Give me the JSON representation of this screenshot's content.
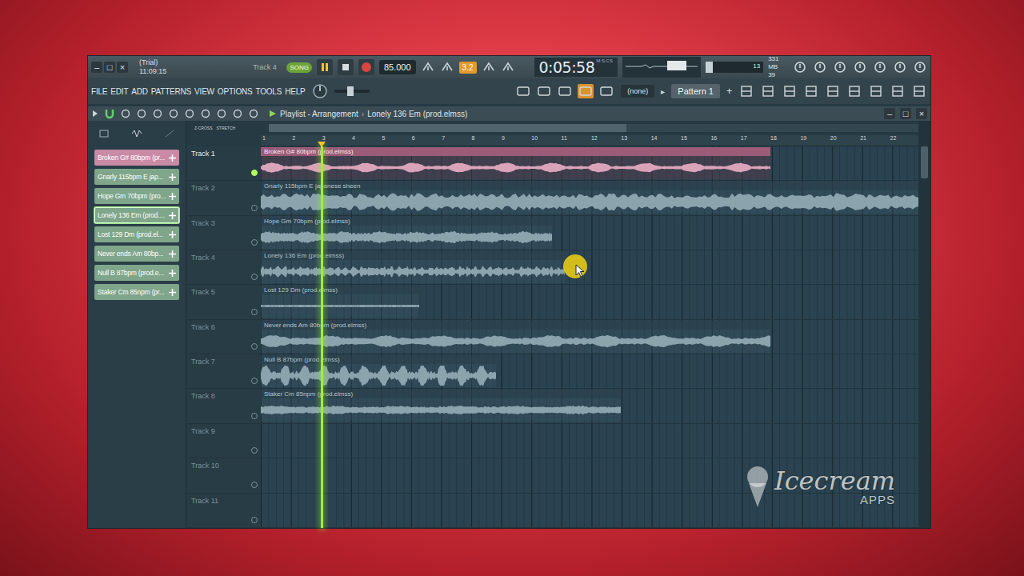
{
  "window": {
    "buttons": [
      "–",
      "□",
      "×"
    ],
    "trial": "(Trial)",
    "clock": "11:09:15",
    "hint": "Track 4"
  },
  "transport": {
    "mode": {
      "label": "SONG",
      "selected": true
    },
    "playing": true,
    "recording": false,
    "tempo": "85.000",
    "snap_badge": {
      "label": "3.2",
      "selected": true
    },
    "time": "0:05:58",
    "time_unit": "M:S:CS",
    "cpu": "13",
    "memory": "331 MB",
    "polyphony": "39",
    "cpu_level": 0.13
  },
  "menu": [
    "FILE",
    "EDIT",
    "ADD",
    "PATTERNS",
    "VIEW",
    "OPTIONS",
    "TOOLS",
    "HELP"
  ],
  "pattern_selector": {
    "channel": "(none)",
    "arrow": "▸",
    "pattern": "Pattern 1",
    "add": "+"
  },
  "playlist": {
    "title": "Playlist - Arrangement",
    "separator": "›",
    "current": "Lonely 136 Em (prod.elmss)",
    "buttons": [
      "–",
      "□",
      "×"
    ],
    "tool_labels": [
      "Z-CROSS",
      "STRETCH"
    ],
    "ruler": [
      "1",
      "2",
      "3",
      "4",
      "5",
      "6",
      "7",
      "8",
      "9",
      "10",
      "11",
      "12",
      "13",
      "14",
      "15",
      "16",
      "17",
      "18",
      "19",
      "20",
      "21",
      "22"
    ],
    "playhead": 0.091,
    "overview": {
      "level": 0.55
    }
  },
  "picker": [
    {
      "label": "Broken G# 80bpm (pr...",
      "color": "#c98aa6",
      "selected": false
    },
    {
      "label": "Gnarly 115bpm E jap...",
      "color": "#7fa58a",
      "selected": false
    },
    {
      "label": "Hope Gm 70bpm (pro...",
      "color": "#7fa58a",
      "selected": false
    },
    {
      "label": "Lonely 136 Em (prod....",
      "color": "#7fa58a",
      "selected": true
    },
    {
      "label": "Lost 129 Dm (prod.el...",
      "color": "#7fa58a",
      "selected": false
    },
    {
      "label": "Never ends Am 80bp...",
      "color": "#7fa58a",
      "selected": false
    },
    {
      "label": "Null B 87bpm (prod.e...",
      "color": "#7fa58a",
      "selected": false
    },
    {
      "label": "Staker Cm 85npm (pr...",
      "color": "#7fa58a",
      "selected": false
    }
  ],
  "tracks": [
    {
      "name": "Track 1",
      "led_on": true,
      "clip": {
        "label": "Broken G# 80bpm (prod.elmss)",
        "level": 0.775,
        "color": "#d9a3ba",
        "selected": true
      }
    },
    {
      "name": "Track 2",
      "led_on": false,
      "clip": {
        "label": "Gnarly 115bpm E japanese sheen",
        "level": 1.0,
        "color": "#8aa3ad",
        "selected": false
      }
    },
    {
      "name": "Track 3",
      "led_on": false,
      "clip": {
        "label": "Hope Gm 70bpm (prod.elmss)",
        "level": 0.443,
        "color": "#8aa3ad",
        "selected": false
      }
    },
    {
      "name": "Track 4",
      "led_on": false,
      "clip": {
        "label": "Lonely 136 Em (prod.elmss)",
        "level": 0.462,
        "color": "#8aa3ad",
        "selected": false
      }
    },
    {
      "name": "Track 5",
      "led_on": false,
      "clip": {
        "label": "Lost 129 Dm (prod.elmss)",
        "level": 0.241,
        "color": "#8aa3ad",
        "selected": false
      }
    },
    {
      "name": "Track 6",
      "led_on": false,
      "clip": {
        "label": "Never ends Am 80bpm (prod.elmss)",
        "level": 0.775,
        "color": "#8aa3ad",
        "selected": false
      }
    },
    {
      "name": "Track 7",
      "led_on": false,
      "clip": {
        "label": "Null B 87bpm (prod.elmss)",
        "level": 0.358,
        "color": "#8aa3ad",
        "selected": false
      }
    },
    {
      "name": "Track 8",
      "led_on": false,
      "clip": {
        "label": "Staker Cm 85npm (prod.elmss)",
        "level": 0.548,
        "color": "#8aa3ad",
        "selected": false
      }
    },
    {
      "name": "Track 9",
      "led_on": false,
      "clip": null
    },
    {
      "name": "Track 10",
      "led_on": false,
      "clip": null
    },
    {
      "name": "Track 11",
      "led_on": false,
      "clip": null
    }
  ],
  "watermark": {
    "brand": "Icecream",
    "sub": "APPS"
  }
}
